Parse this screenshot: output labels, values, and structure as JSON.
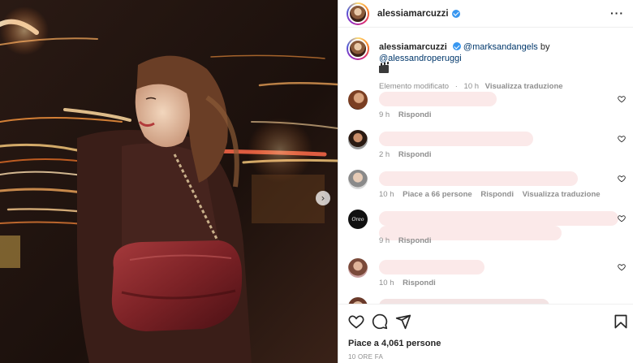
{
  "post": {
    "username": "alessiamarcuzzi",
    "verified_icon": "verified-badge-icon",
    "more_icon": "more-options-icon",
    "accent": "#3897f0"
  },
  "caption": {
    "username": "alessiamarcuzzi",
    "mention1": "@marksandangels",
    "by": "by",
    "mention2": "@alessandroperuggi",
    "emoji_icon": "clapperboard-icon",
    "edited": "Elemento modificato",
    "time": "10 h",
    "translate": "Visualizza traduzione"
  },
  "comments": [
    {
      "time": "9 h",
      "reply": "Rispondi"
    },
    {
      "time": "2 h",
      "reply": "Rispondi"
    },
    {
      "time": "10 h",
      "likes": "Piace a 66 persone",
      "reply": "Rispondi",
      "translate": "Visualizza traduzione"
    },
    {
      "time": "9 h",
      "reply": "Rispondi"
    },
    {
      "time": "10 h",
      "reply": "Rispondi"
    }
  ],
  "actions": {
    "like_icon": "heart-icon",
    "comment_icon": "comment-icon",
    "share_icon": "share-icon",
    "save_icon": "bookmark-icon",
    "likes_total": "Piace a 4,061 persone",
    "time_ago": "10 ORE FA"
  },
  "colors": {
    "text": "#262626",
    "muted": "#8e8e8e",
    "link": "#00376b",
    "border": "#dbdbdb"
  }
}
